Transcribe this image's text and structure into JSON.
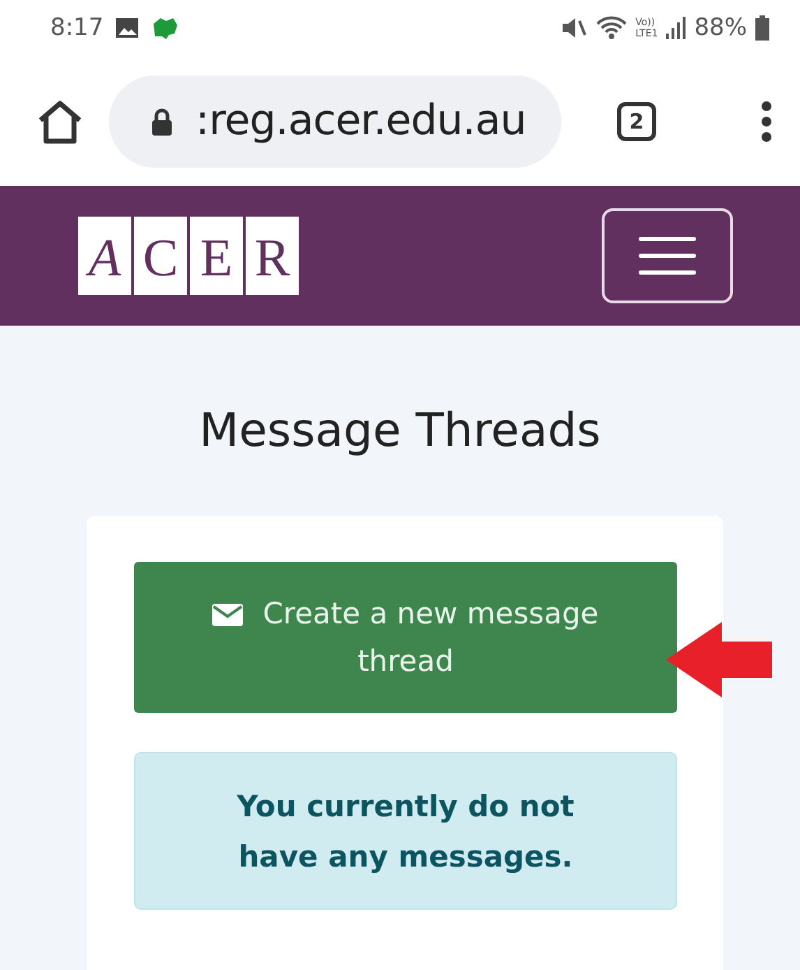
{
  "status_bar": {
    "time": "8:17",
    "volte": "Vo))",
    "lte": "LTE1",
    "battery": "88%"
  },
  "browser_toolbar": {
    "url": ":reg.acer.edu.au",
    "tab_count": "2"
  },
  "header": {
    "logo_letters": [
      "A",
      "C",
      "E",
      "R"
    ]
  },
  "page": {
    "title": "Message Threads",
    "create_button": "Create a new message thread",
    "alert": "You currently do not have any messages."
  }
}
